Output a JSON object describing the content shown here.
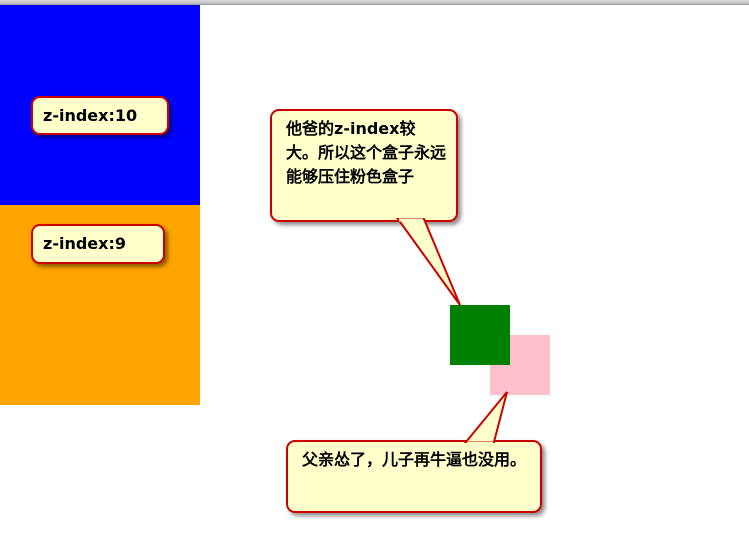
{
  "boxes": {
    "blue": {
      "color": "#0000ff"
    },
    "orange": {
      "color": "#ffa500"
    },
    "green": {
      "color": "#008000"
    },
    "pink": {
      "color": "#ffc0cb"
    }
  },
  "callouts": {
    "blue_label": "z-index:10",
    "orange_label": "z-index:9",
    "father_note": "他爸的z-index较大。所以这个盒子永远能够压住粉色盒子",
    "son_note": "父亲怂了，儿子再牛逼也没用。"
  },
  "colors": {
    "callout_fill": "#ffffcc",
    "callout_border": "#cc0000"
  }
}
